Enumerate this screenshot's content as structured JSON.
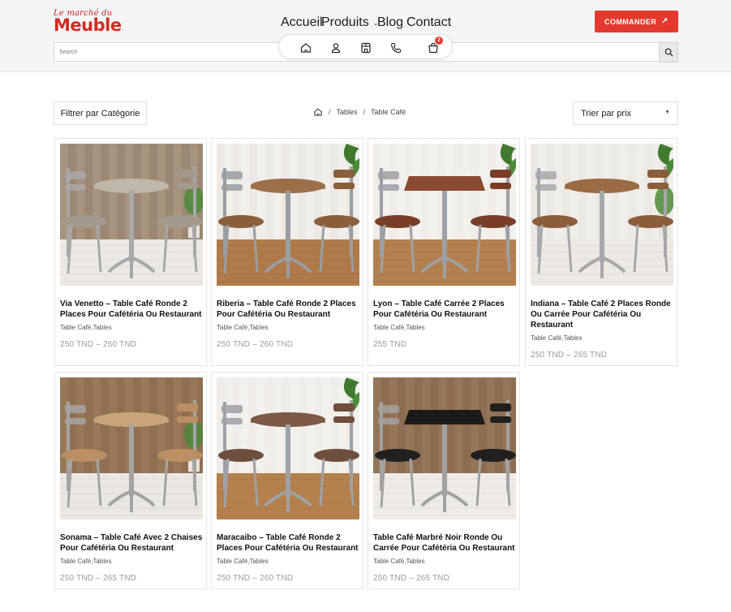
{
  "logo": {
    "small": "Le marché du",
    "big": "Meuble"
  },
  "nav": {
    "items": [
      {
        "label": "Accueil"
      },
      {
        "label": "Produits"
      },
      {
        "label": "Blog"
      },
      {
        "label": "Contact"
      }
    ]
  },
  "cta": {
    "label": "COMMANDER"
  },
  "search": {
    "placeholder": "Search",
    "value": ""
  },
  "cart": {
    "count": "2"
  },
  "filter": {
    "label": "Filtrer par Catégorie"
  },
  "breadcrumb": {
    "items": [
      "Tables",
      "Table Café"
    ]
  },
  "sort": {
    "label": "Trier par prix"
  },
  "colors": {
    "brand": "#e23a2e",
    "logo": "#d62a22"
  },
  "products": [
    {
      "title": "Via Venetto – Table Café Ronde 2 Places Pour Cafétéria Ou Restaurant",
      "categories": "Table Café,Tables",
      "price": "250 TND  –  260 TND"
    },
    {
      "title": "Riberia – Table Café Ronde 2 Places Pour Cafétéria Ou Restaurant",
      "categories": "Table Café,Tables",
      "price": "250 TND  –  260 TND"
    },
    {
      "title": "Lyon – Table Café Carrée 2 Places Pour Cafétéria Ou Restaurant",
      "categories": "Table Café,Tables",
      "price": "255 TND"
    },
    {
      "title": "Indiana – Table Café 2 Places Ronde Ou Carrée Pour Cafétéria Ou Restaurant",
      "categories": "Table Café,Tables",
      "price": "250 TND  –  265 TND"
    },
    {
      "title": "Sonama – Table Café Avec 2 Chaises Pour Cafétéria Ou Restaurant",
      "categories": "Table Café,Tables",
      "price": "250 TND  –  265 TND"
    },
    {
      "title": "Maracaibo – Table Café Ronde 2 Places Pour Cafétéria Ou Restaurant",
      "categories": "Table Café,Tables",
      "price": "250 TND  –  260 TND"
    },
    {
      "title": "Table Café Marbré Noir Ronde Ou Carrée Pour Cafétéria Ou Restaurant",
      "categories": "Table Café,Tables",
      "price": "250 TND  –  265 TND"
    }
  ]
}
